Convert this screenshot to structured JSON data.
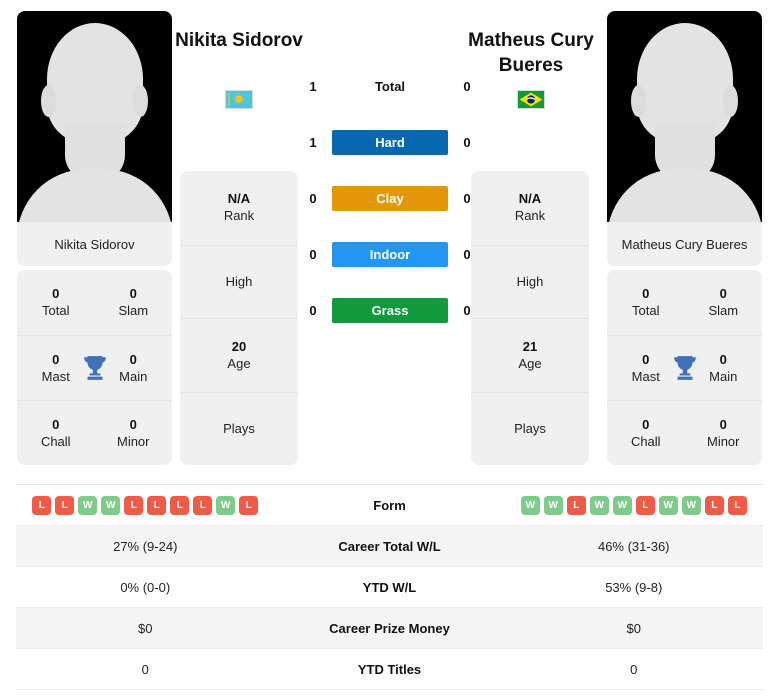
{
  "players": {
    "left": {
      "headline": "Nikita Sidorov",
      "card_name": "Nikita Sidorov",
      "flag": "kazakhstan-flag",
      "rank_value": "N/A",
      "rank_label": "Rank",
      "high_label": "High",
      "high_value": "",
      "age_value": "20",
      "age_label": "Age",
      "plays_label": "Plays",
      "plays_value": "",
      "titles": [
        {
          "num": "0",
          "label": "Total"
        },
        {
          "num": "0",
          "label": "Slam"
        },
        {
          "num": "0",
          "label": "Mast"
        },
        {
          "num": "0",
          "label": "Main"
        },
        {
          "num": "0",
          "label": "Chall"
        },
        {
          "num": "0",
          "label": "Minor"
        }
      ]
    },
    "right": {
      "headline": "Matheus Cury Bueres",
      "card_name": "Matheus Cury Bueres",
      "flag": "brazil-flag",
      "rank_value": "N/A",
      "rank_label": "Rank",
      "high_label": "High",
      "high_value": "",
      "age_value": "21",
      "age_label": "Age",
      "plays_label": "Plays",
      "plays_value": "",
      "titles": [
        {
          "num": "0",
          "label": "Total"
        },
        {
          "num": "0",
          "label": "Slam"
        },
        {
          "num": "0",
          "label": "Mast"
        },
        {
          "num": "0",
          "label": "Main"
        },
        {
          "num": "0",
          "label": "Chall"
        },
        {
          "num": "0",
          "label": "Minor"
        }
      ]
    }
  },
  "h2h": {
    "rows": [
      {
        "label": "Total",
        "left": "1",
        "right": "0",
        "color": "",
        "badge": false
      },
      {
        "label": "Hard",
        "left": "1",
        "right": "0",
        "color": "#0568b0",
        "badge": true
      },
      {
        "label": "Clay",
        "left": "0",
        "right": "0",
        "color": "#e39709",
        "badge": true
      },
      {
        "label": "Indoor",
        "left": "0",
        "right": "0",
        "color": "#2196f3",
        "badge": true
      },
      {
        "label": "Grass",
        "left": "0",
        "right": "0",
        "color": "#0f9a3c",
        "badge": true
      }
    ]
  },
  "stats_table": {
    "win_color": "#7ecb8b",
    "loss_color": "#ef5b46",
    "rows": [
      {
        "label": "Form",
        "type": "form",
        "left_form": [
          "L",
          "L",
          "W",
          "W",
          "L",
          "L",
          "L",
          "L",
          "W",
          "L"
        ],
        "right_form": [
          "W",
          "W",
          "L",
          "W",
          "W",
          "L",
          "W",
          "W",
          "L",
          "L"
        ]
      },
      {
        "label": "Career Total W/L",
        "type": "text",
        "left": "27% (9-24)",
        "right": "46% (31-36)"
      },
      {
        "label": "YTD W/L",
        "type": "text",
        "left": "0% (0-0)",
        "right": "53% (9-8)"
      },
      {
        "label": "Career Prize Money",
        "type": "text",
        "left": "$0",
        "right": "$0"
      },
      {
        "label": "YTD Titles",
        "type": "text",
        "left": "0",
        "right": "0"
      }
    ]
  }
}
